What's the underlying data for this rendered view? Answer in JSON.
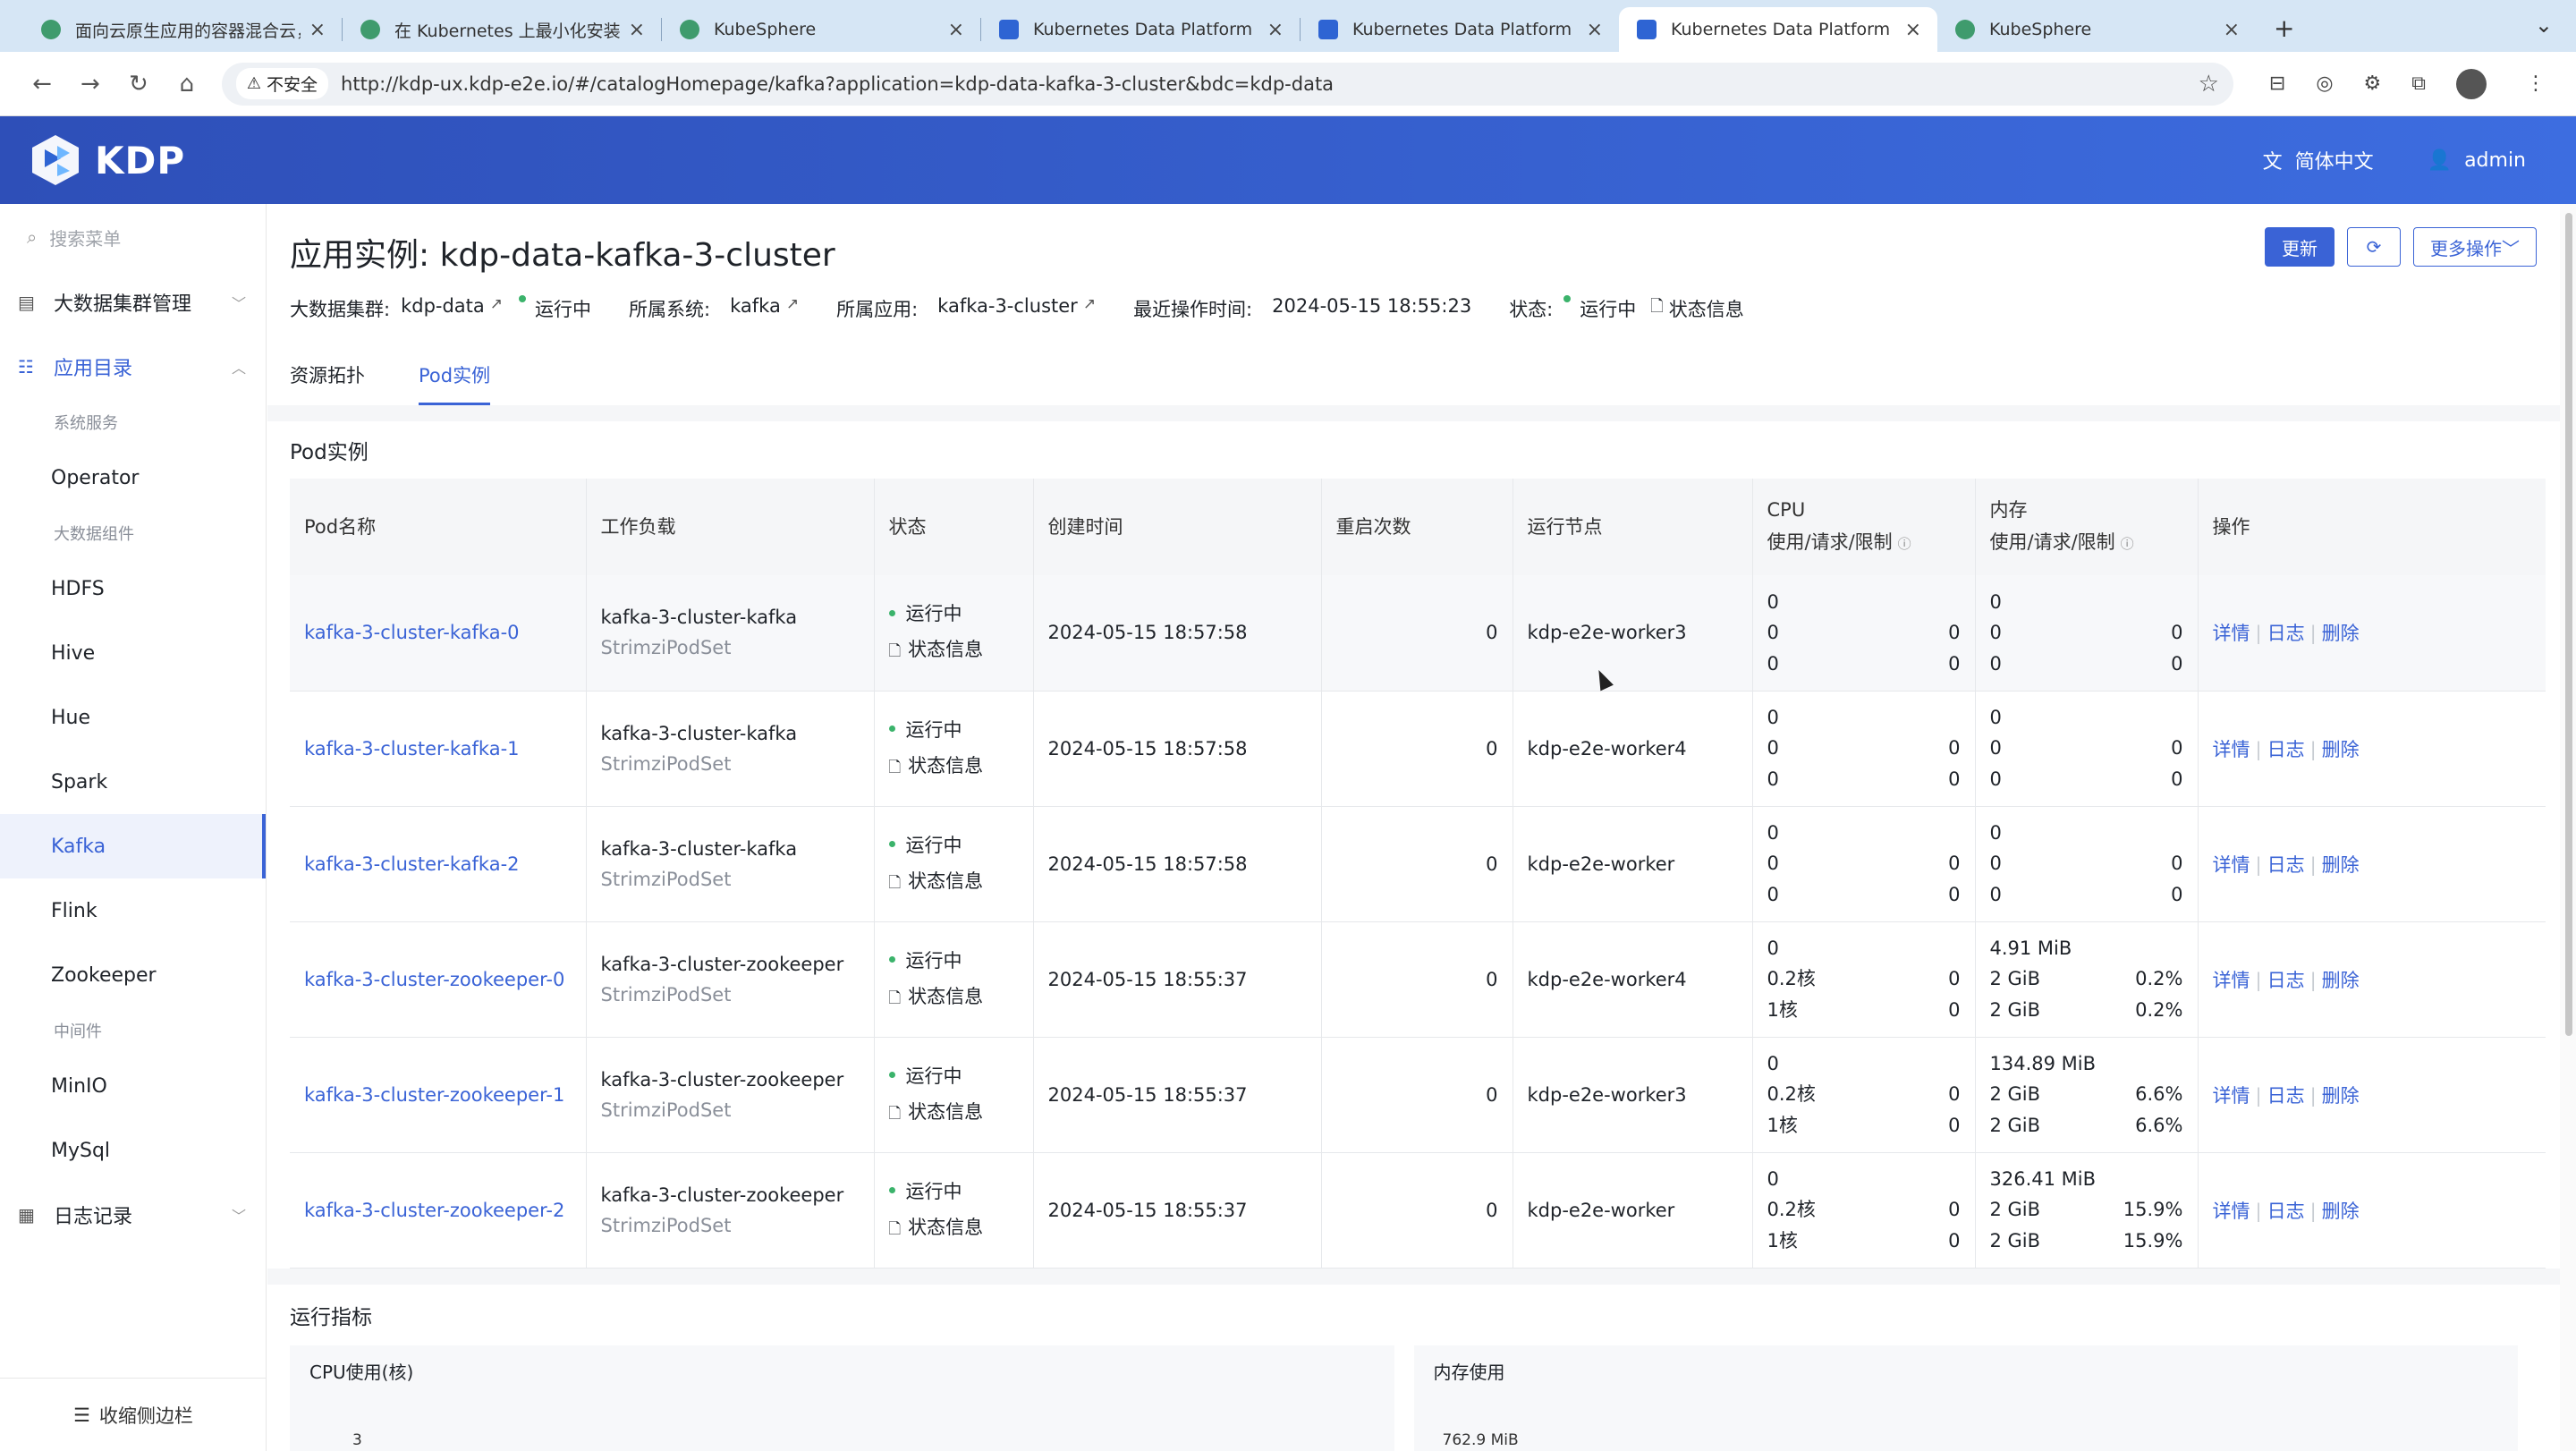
{
  "browser": {
    "tabs": [
      {
        "title": "面向云原生应用的容器混合云，",
        "icon": "kubesphere-icon",
        "active": false
      },
      {
        "title": "在 Kubernetes 上最小化安装 K",
        "icon": "kubesphere-icon",
        "active": false
      },
      {
        "title": "KubeSphere",
        "icon": "kubesphere-icon",
        "active": false
      },
      {
        "title": "Kubernetes Data Platform",
        "icon": "kdp-icon",
        "active": false
      },
      {
        "title": "Kubernetes Data Platform",
        "icon": "kdp-icon",
        "active": false
      },
      {
        "title": "Kubernetes Data Platform",
        "icon": "kdp-icon",
        "active": true
      },
      {
        "title": "KubeSphere",
        "icon": "kubesphere-icon",
        "active": false
      }
    ],
    "insecure_label": "不安全",
    "url": "http://kdp-ux.kdp-e2e.io/#/catalogHomepage/kafka?application=kdp-data-kafka-3-cluster&bdc=kdp-data"
  },
  "header": {
    "brand": "KDP",
    "language": "简体中文",
    "user": "admin"
  },
  "sidebar": {
    "search_placeholder": "搜索菜单",
    "group_bigdata": "大数据集群管理",
    "group_catalog": "应用目录",
    "sub_system": "系统服务",
    "item_operator": "Operator",
    "sub_components": "大数据组件",
    "items": [
      "HDFS",
      "Hive",
      "Hue",
      "Spark",
      "Kafka",
      "Flink",
      "Zookeeper"
    ],
    "active_item": "Kafka",
    "sub_middleware": "中间件",
    "middleware": [
      "MinIO",
      "MySql"
    ],
    "group_logs": "日志记录",
    "collapse_label": "收缩侧边栏"
  },
  "page": {
    "title": "应用实例: kdp-data-kafka-3-cluster",
    "btn_update": "更新",
    "btn_more": "更多操作",
    "meta": {
      "cluster_label": "大数据集群:",
      "cluster_value": "kdp-data",
      "cluster_status": "运行中",
      "system_label": "所属系统:",
      "system_value": "kafka",
      "app_label": "所属应用:",
      "app_value": "kafka-3-cluster",
      "time_label": "最近操作时间:",
      "time_value": "2024-05-15 18:55:23",
      "status_label": "状态:",
      "status_value": "运行中",
      "status_info": "状态信息"
    },
    "tabs": [
      "资源拓扑",
      "Pod实例"
    ],
    "active_tab": "Pod实例"
  },
  "pods": {
    "title": "Pod实例",
    "headers": {
      "name": "Pod名称",
      "workload": "工作负载",
      "status": "状态",
      "created": "创建时间",
      "restarts": "重启次数",
      "node": "运行节点",
      "cpu": "CPU",
      "cpu_sub": "使用/请求/限制",
      "mem": "内存",
      "mem_sub": "使用/请求/限制",
      "ops": "操作"
    },
    "status_info": "状态信息",
    "ops": {
      "detail": "详情",
      "log": "日志",
      "delete": "删除"
    },
    "rows": [
      {
        "name": "kafka-3-cluster-kafka-0",
        "workload": "kafka-3-cluster-kafka",
        "kind": "StrimziPodSet",
        "status": "运行中",
        "created": "2024-05-15 18:57:58",
        "restarts": "0",
        "node": "kdp-e2e-worker3",
        "cpu": [
          [
            "0",
            ""
          ],
          [
            "0",
            "0"
          ],
          [
            "0",
            "0"
          ]
        ],
        "mem": [
          [
            "0",
            ""
          ],
          [
            "0",
            "0"
          ],
          [
            "0",
            "0"
          ]
        ]
      },
      {
        "name": "kafka-3-cluster-kafka-1",
        "workload": "kafka-3-cluster-kafka",
        "kind": "StrimziPodSet",
        "status": "运行中",
        "created": "2024-05-15 18:57:58",
        "restarts": "0",
        "node": "kdp-e2e-worker4",
        "cpu": [
          [
            "0",
            ""
          ],
          [
            "0",
            "0"
          ],
          [
            "0",
            "0"
          ]
        ],
        "mem": [
          [
            "0",
            ""
          ],
          [
            "0",
            "0"
          ],
          [
            "0",
            "0"
          ]
        ]
      },
      {
        "name": "kafka-3-cluster-kafka-2",
        "workload": "kafka-3-cluster-kafka",
        "kind": "StrimziPodSet",
        "status": "运行中",
        "created": "2024-05-15 18:57:58",
        "restarts": "0",
        "node": "kdp-e2e-worker",
        "cpu": [
          [
            "0",
            ""
          ],
          [
            "0",
            "0"
          ],
          [
            "0",
            "0"
          ]
        ],
        "mem": [
          [
            "0",
            ""
          ],
          [
            "0",
            "0"
          ],
          [
            "0",
            "0"
          ]
        ]
      },
      {
        "name": "kafka-3-cluster-zookeeper-0",
        "workload": "kafka-3-cluster-zookeeper",
        "kind": "StrimziPodSet",
        "status": "运行中",
        "created": "2024-05-15 18:55:37",
        "restarts": "0",
        "node": "kdp-e2e-worker4",
        "cpu": [
          [
            "0",
            ""
          ],
          [
            "0.2核",
            "0"
          ],
          [
            "1核",
            "0"
          ]
        ],
        "mem": [
          [
            "4.91 MiB",
            ""
          ],
          [
            "2 GiB",
            "0.2%"
          ],
          [
            "2 GiB",
            "0.2%"
          ]
        ]
      },
      {
        "name": "kafka-3-cluster-zookeeper-1",
        "workload": "kafka-3-cluster-zookeeper",
        "kind": "StrimziPodSet",
        "status": "运行中",
        "created": "2024-05-15 18:55:37",
        "restarts": "0",
        "node": "kdp-e2e-worker3",
        "cpu": [
          [
            "0",
            ""
          ],
          [
            "0.2核",
            "0"
          ],
          [
            "1核",
            "0"
          ]
        ],
        "mem": [
          [
            "134.89 MiB",
            ""
          ],
          [
            "2 GiB",
            "6.6%"
          ],
          [
            "2 GiB",
            "6.6%"
          ]
        ]
      },
      {
        "name": "kafka-3-cluster-zookeeper-2",
        "workload": "kafka-3-cluster-zookeeper",
        "kind": "StrimziPodSet",
        "status": "运行中",
        "created": "2024-05-15 18:55:37",
        "restarts": "0",
        "node": "kdp-e2e-worker",
        "cpu": [
          [
            "0",
            ""
          ],
          [
            "0.2核",
            "0"
          ],
          [
            "1核",
            "0"
          ]
        ],
        "mem": [
          [
            "326.41 MiB",
            ""
          ],
          [
            "2 GiB",
            "15.9%"
          ],
          [
            "2 GiB",
            "15.9%"
          ]
        ]
      }
    ]
  },
  "metrics": {
    "title": "运行指标",
    "cpu_title": "CPU使用(核)",
    "cpu_tick": "3",
    "mem_title": "内存使用",
    "mem_tick": "762.9 MiB"
  },
  "colors": {
    "accent": "#3a63d6",
    "running": "#3bb36b",
    "header_start": "#2e4fb8",
    "header_end": "#3d6de0"
  }
}
